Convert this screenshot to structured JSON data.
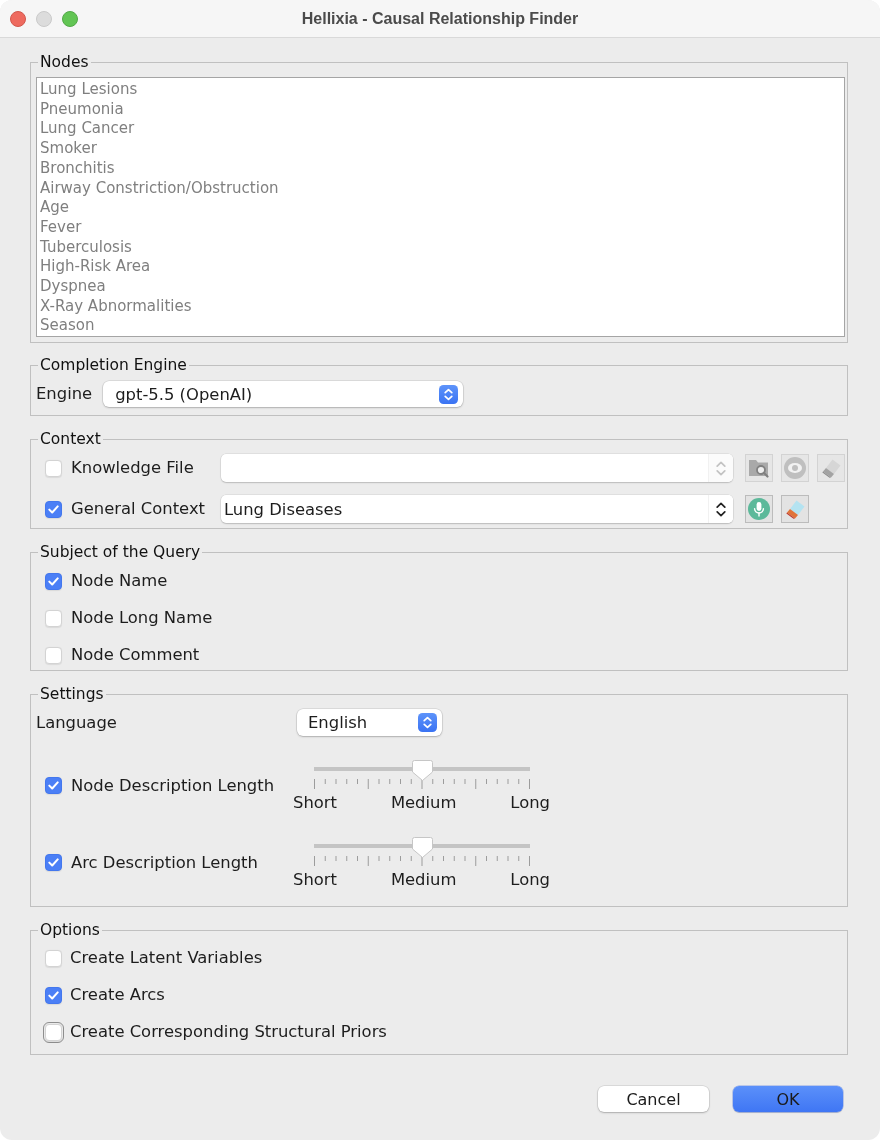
{
  "window": {
    "title": "Hellixia - Causal Relationship Finder",
    "controls": [
      {
        "kind": "close",
        "disabled": false
      },
      {
        "kind": "minimize",
        "disabled": true
      },
      {
        "kind": "zoom",
        "disabled": false
      }
    ]
  },
  "nodes": {
    "legend": "Nodes",
    "disabled": true,
    "items": [
      "Lung Lesions",
      "Pneumonia",
      "Lung Cancer",
      "Smoker",
      "Bronchitis",
      "Airway Constriction/Obstruction",
      "Age",
      "Fever",
      "Tuberculosis",
      "High-Risk Area",
      "Dyspnea",
      "X-Ray Abnormalities",
      "Season"
    ]
  },
  "completion_engine": {
    "legend": "Completion Engine",
    "label": "Engine",
    "value": "gpt-5.5 (OpenAI)"
  },
  "context": {
    "legend": "Context",
    "rows": [
      {
        "label": "Knowledge File",
        "checked": false,
        "field": {
          "disabled": true
        },
        "buttons": [
          {
            "kind": "browse",
            "disabled": true
          },
          {
            "kind": "view",
            "disabled": true
          },
          {
            "kind": "clear",
            "disabled": true
          }
        ]
      },
      {
        "label": "General Context",
        "checked": true,
        "field": {
          "disabled": false,
          "value": "Lung Diseases"
        },
        "buttons": [
          {
            "kind": "voice",
            "disabled": false
          },
          {
            "kind": "clear",
            "disabled": false
          }
        ]
      }
    ]
  },
  "subject": {
    "legend": "Subject of the Query",
    "items": [
      {
        "label": "Node Name",
        "checked": true
      },
      {
        "label": "Node Long Name",
        "checked": false
      },
      {
        "label": "Node Comment",
        "checked": false
      }
    ]
  },
  "settings": {
    "legend": "Settings",
    "language": {
      "label": "Language",
      "value": "English"
    },
    "sliders": [
      {
        "label": "Node Description Length",
        "checked": true,
        "level": 0.5,
        "scale": [
          "Short",
          "Medium",
          "Long"
        ]
      },
      {
        "label": "Arc Description Length",
        "checked": true,
        "level": 0.5,
        "scale": [
          "Short",
          "Medium",
          "Long"
        ]
      }
    ]
  },
  "options": {
    "legend": "Options",
    "items": [
      {
        "label": "Create Latent Variables",
        "checked": false,
        "focused": false
      },
      {
        "label": "Create Arcs",
        "checked": true,
        "focused": false
      },
      {
        "label": "Create Corresponding Structural Priors",
        "checked": false,
        "focused": true
      }
    ]
  },
  "buttons": [
    {
      "label": "Cancel",
      "default": false
    },
    {
      "label": "OK",
      "default": true
    }
  ]
}
